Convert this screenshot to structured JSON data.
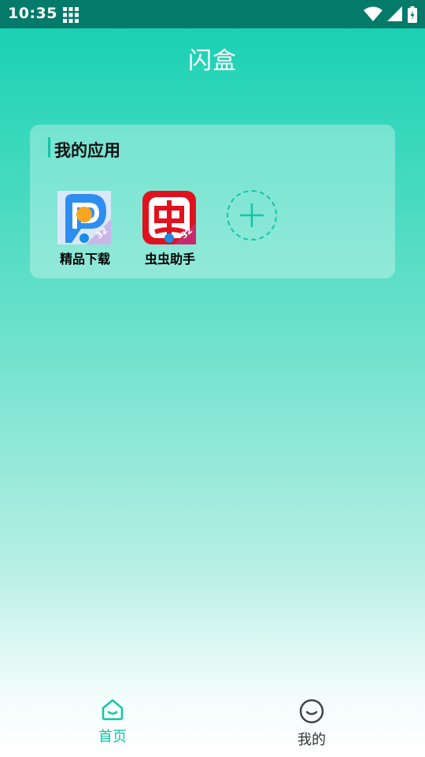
{
  "status_bar": {
    "time": "10:35"
  },
  "header": {
    "title": "闪盒"
  },
  "my_apps": {
    "title": "我的应用",
    "apps": [
      {
        "label": "精品下载",
        "icon": "pp-assistant-icon",
        "badge": "32"
      },
      {
        "label": "虫虫助手",
        "icon": "chongchong-icon",
        "badge": "32"
      }
    ],
    "add_icon": "plus-icon"
  },
  "bottom_nav": {
    "items": [
      {
        "label": "首页",
        "icon": "home-icon",
        "active": true
      },
      {
        "label": "我的",
        "icon": "smiley-icon",
        "active": false
      }
    ]
  },
  "colors": {
    "accent": "#12c6a8",
    "status_bar": "#037a6a",
    "nav_inactive": "#333333"
  }
}
